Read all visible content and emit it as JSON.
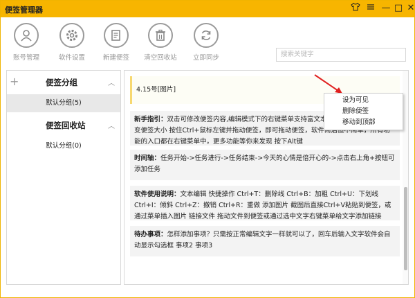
{
  "app": {
    "title": "便签管理器"
  },
  "window_controls": {
    "skin_icon": "shirt-icon",
    "menu_icon": "menu-icon",
    "min": "—",
    "max": "□",
    "close": "✕"
  },
  "toolbar": {
    "items": [
      {
        "label": "账号管理",
        "icon": "user-icon"
      },
      {
        "label": "软件设置",
        "icon": "gear-icon"
      },
      {
        "label": "新建便签",
        "icon": "new-note-icon"
      },
      {
        "label": "清空回收站",
        "icon": "trash-icon"
      },
      {
        "label": "立即同步",
        "icon": "sync-icon"
      }
    ]
  },
  "search": {
    "placeholder": "搜索关键字"
  },
  "sidebar": {
    "groups_header": "便签分组",
    "groups_plus": "+",
    "groups_item": "默认分组(5)",
    "recycle_header": "便签回收站",
    "recycle_item": "默认分组(0)",
    "chevron": "︿"
  },
  "notes": [
    {
      "text": "4.15号[图片]"
    },
    {
      "title": "新手指引：",
      "body": "双击可修改便签内容,编辑模式下的右键菜单支持富文本编辑，右下角拖动可改变便签大小  按住Ctrl+鼠标左键并拖动便签，即可拖动便签，软件简洁但不简单，所有功能的入口都在右键菜单中，更多功能等你来发现  按下Alt键"
    },
    {
      "title": "时间轴：",
      "body": "任务开始->任务进行->任务结束->今天的心情是倍开心的->点击右上角+按钮可添加任务"
    },
    {
      "title": "软件使用说明：",
      "body": "文本编辑  快捷操作 Ctrl+T：删除线 Ctrl+B：加粗 Ctrl+U：下划线 Ctrl+I：倾斜 Ctrl+Z：撤销 Ctrl+R：重做  添加图片 截图后直接Ctrl+V粘贴到便签，或通过菜单插入图片  链接文件 拖动文件到便签或通过选中文字右键菜单给文字添加链接"
    },
    {
      "title": "待办事项：",
      "body": "怎样添加事项？只需按正常编辑文字一样就可以了，回车后输入文字软件会自动显示勾选框 事项2 事项3"
    }
  ],
  "context_menu": {
    "items": [
      "设为可见",
      "删除便签",
      "移动到顶部"
    ]
  },
  "colors": {
    "titlebar": "#f7b500",
    "annotation_arrow": "#e02020"
  }
}
